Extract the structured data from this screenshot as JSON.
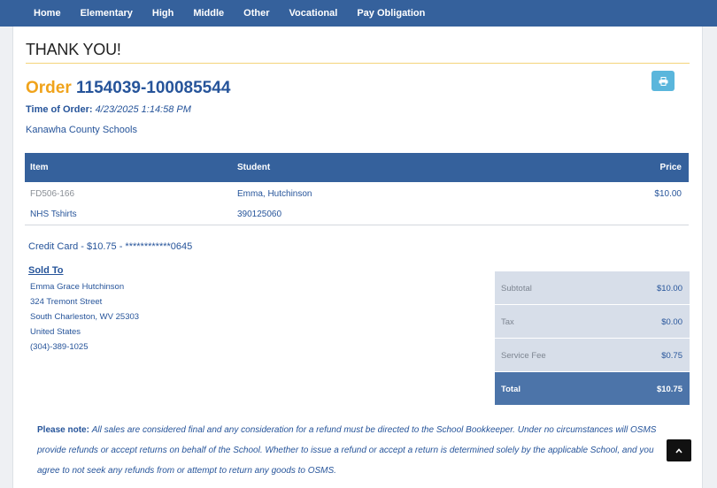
{
  "nav": {
    "items": [
      "Home",
      "Elementary",
      "High",
      "Middle",
      "Other",
      "Vocational",
      "Pay Obligation"
    ]
  },
  "page": {
    "title": "THANK YOU!"
  },
  "order": {
    "label": "Order",
    "number": "1154039-100085544",
    "time_label": "Time of Order:",
    "time_value": "4/23/2025 1:14:58 PM",
    "district": "Kanawha County Schools"
  },
  "print_icon": "printer-icon",
  "items_table": {
    "headers": {
      "item": "Item",
      "student": "Student",
      "price": "Price"
    },
    "rows": [
      {
        "item_code": "FD506-166",
        "item_name": "NHS Tshirts",
        "student_name": "Emma, Hutchinson",
        "student_id": "390125060",
        "price": "$10.00"
      }
    ]
  },
  "payment": {
    "text": "Credit Card - $10.75 - ************0645"
  },
  "sold_to": {
    "label": "Sold To",
    "lines": [
      "Emma Grace Hutchinson",
      "324 Tremont Street",
      "South Charleston, WV 25303",
      "United States",
      "(304)-389-1025"
    ]
  },
  "totals": {
    "subtotal_label": "Subtotal",
    "subtotal_value": "$10.00",
    "tax_label": "Tax",
    "tax_value": "$0.00",
    "fee_label": "Service Fee",
    "fee_value": "$0.75",
    "total_label": "Total",
    "total_value": "$10.75"
  },
  "note": {
    "label": "Please note:",
    "text": "All sales are considered final and any consideration for a refund must be directed to the School Bookkeeper. Under no circumstances will OSMS provide refunds or accept returns on behalf of the School. Whether to issue a refund or accept a return is determined solely by the applicable School, and you agree to not seek any refunds from or attempt to return any goods to OSMS."
  },
  "colors": {
    "nav_bg": "#35619c",
    "order_accent": "#f0a31b",
    "link_blue": "#26549a",
    "print_button": "#5ab6dc",
    "totals_bg": "#d7dee9",
    "total_row_bg": "#4c74a9"
  },
  "scroll_top_icon": "chevron-up-icon"
}
